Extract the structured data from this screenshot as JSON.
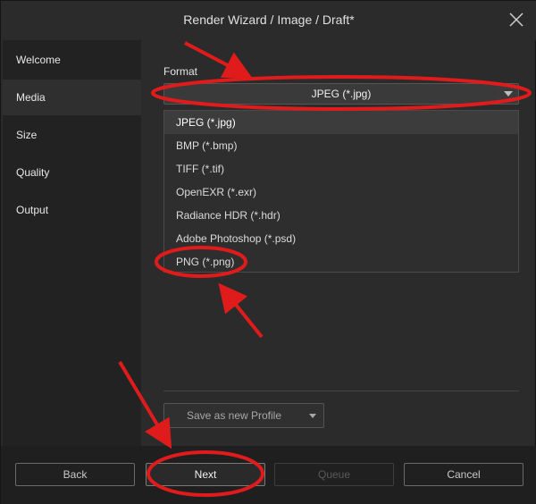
{
  "window": {
    "title": "Render Wizard / Image / Draft*"
  },
  "sidebar": {
    "items": [
      {
        "label": "Welcome",
        "active": false
      },
      {
        "label": "Media",
        "active": true
      },
      {
        "label": "Size",
        "active": false
      },
      {
        "label": "Quality",
        "active": false
      },
      {
        "label": "Output",
        "active": false
      }
    ]
  },
  "media": {
    "format_label": "Format",
    "selected_format": "JPEG (*.jpg)",
    "options": [
      "JPEG (*.jpg)",
      "BMP (*.bmp)",
      "TIFF (*.tif)",
      "OpenEXR (*.exr)",
      "Radiance HDR (*.hdr)",
      "Adobe Photoshop (*.psd)",
      "PNG (*.png)"
    ],
    "profile_button": "Save as new Profile"
  },
  "footer": {
    "back": "Back",
    "next": "Next",
    "queue": "Queue",
    "cancel": "Cancel"
  },
  "icons": {
    "close": "close-icon",
    "select_arrow": "chevron-down-icon"
  },
  "colors": {
    "background": "#2b2b2b",
    "sidebar": "#222222",
    "annotation": "#e01b1b"
  }
}
